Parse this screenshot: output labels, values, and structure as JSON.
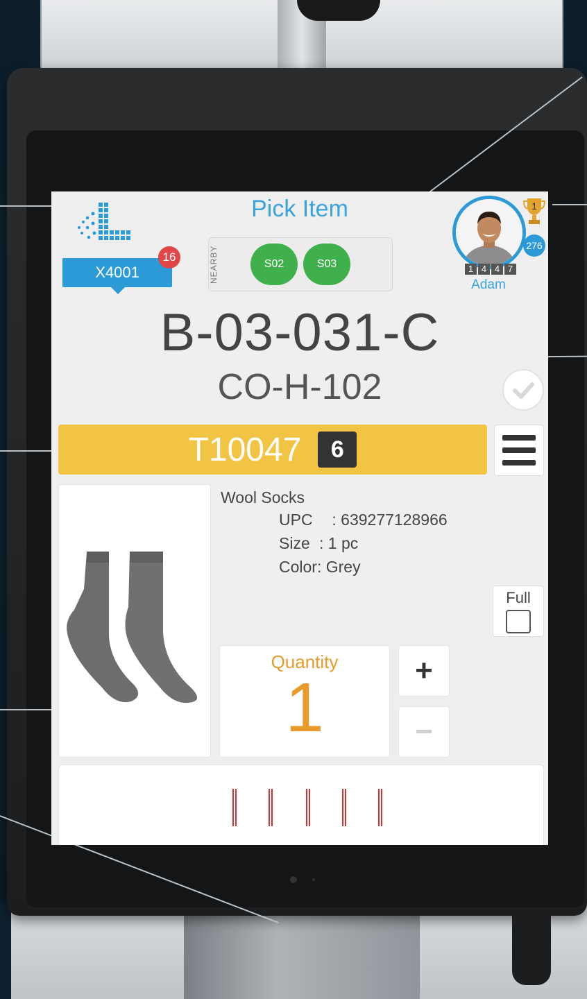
{
  "header": {
    "title": "Pick Item",
    "station": "X4001",
    "station_badge": "16",
    "nearby_label": "NEARBY",
    "nearby": [
      "S02",
      "S03"
    ]
  },
  "user": {
    "name": "Adam",
    "rank": "1",
    "score": "276",
    "digits": [
      "1",
      "4",
      "4",
      "7"
    ]
  },
  "location": {
    "bin": "B-03-031-C",
    "code": "CO-H-102"
  },
  "tote": {
    "id": "T10047",
    "count": "6"
  },
  "product": {
    "name": "Wool Socks",
    "upc_label": "UPC",
    "upc": "639277128966",
    "size_label": "Size",
    "size": "1 pc",
    "color_label": "Color",
    "color": "Grey",
    "image_icon": "socks-image"
  },
  "full": {
    "label": "Full",
    "checked": false
  },
  "quantity": {
    "label": "Quantity",
    "value": "1",
    "plus": "+",
    "minus": "−"
  },
  "colors": {
    "accent": "#2b9ad6",
    "nearby_green": "#3fb04b",
    "tote_yellow": "#f2c443",
    "quantity_orange": "#e89a2b",
    "badge_red": "#e04646"
  }
}
